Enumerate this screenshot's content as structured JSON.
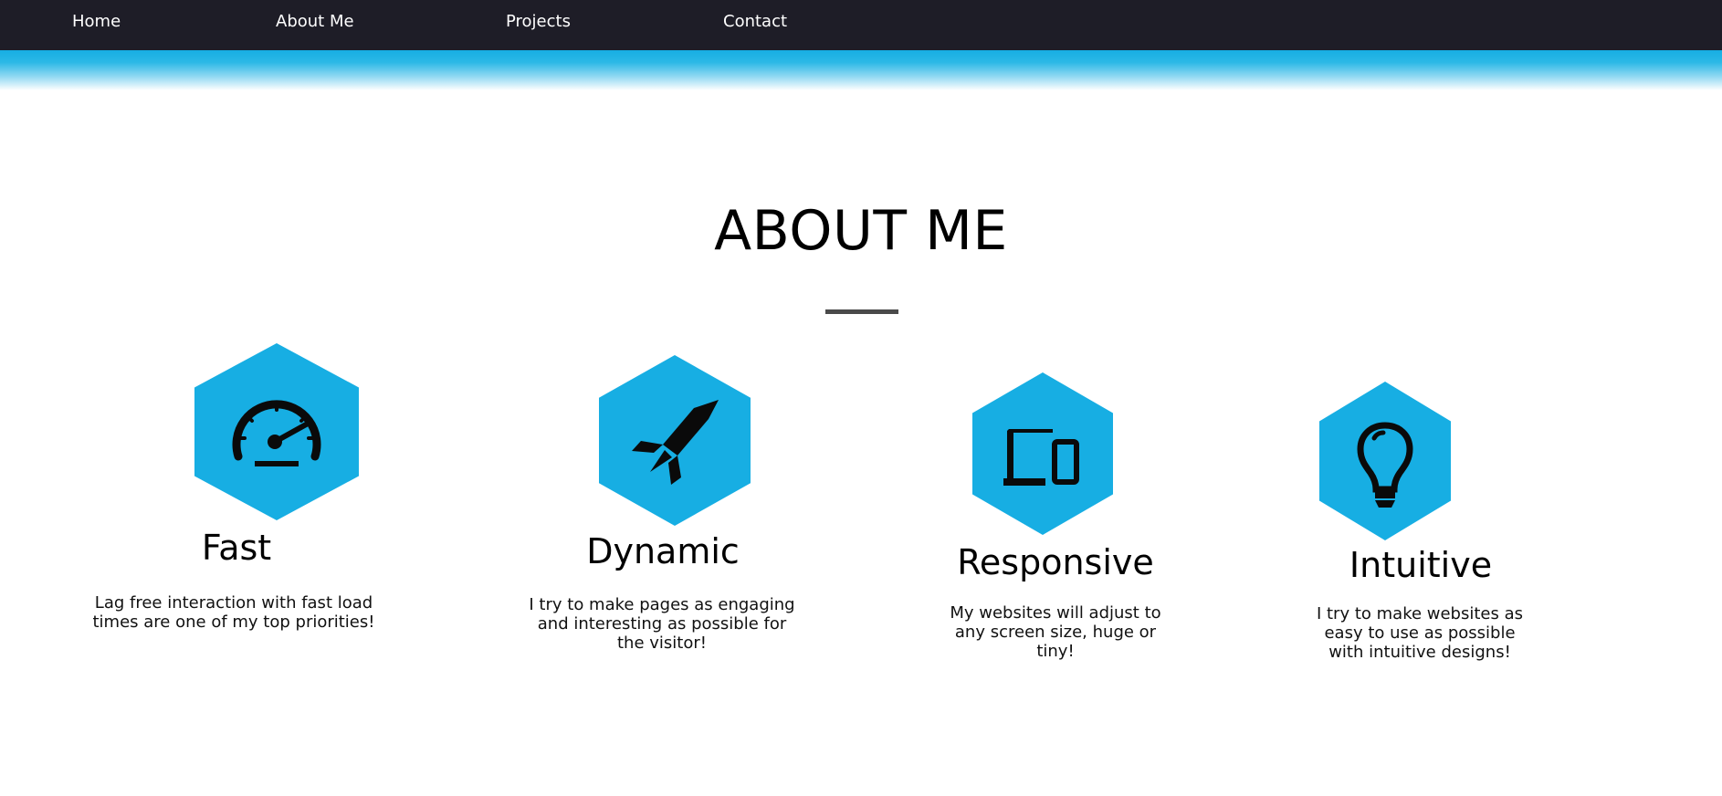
{
  "nav": {
    "items": [
      {
        "label": "Home"
      },
      {
        "label": "About Me"
      },
      {
        "label": "Projects"
      },
      {
        "label": "Contact"
      }
    ]
  },
  "about": {
    "title": "ABOUT ME",
    "features": [
      {
        "icon": "speedometer-icon",
        "title": "Fast",
        "description": "Lag free interaction with fast load times are one of my top priorities!"
      },
      {
        "icon": "rocket-icon",
        "title": "Dynamic",
        "description": "I try to make pages as engaging and interesting as possible for the visitor!"
      },
      {
        "icon": "devices-icon",
        "title": "Responsive",
        "description": "My websites will adjust to any screen size, huge or tiny!"
      },
      {
        "icon": "lightbulb-icon",
        "title": "Intuitive",
        "description": "I try to make websites as easy to use as possible with intuitive designs!"
      }
    ]
  },
  "colors": {
    "nav_background": "#1e1d27",
    "accent": "#17aee3",
    "divider": "#4a4a4a"
  }
}
